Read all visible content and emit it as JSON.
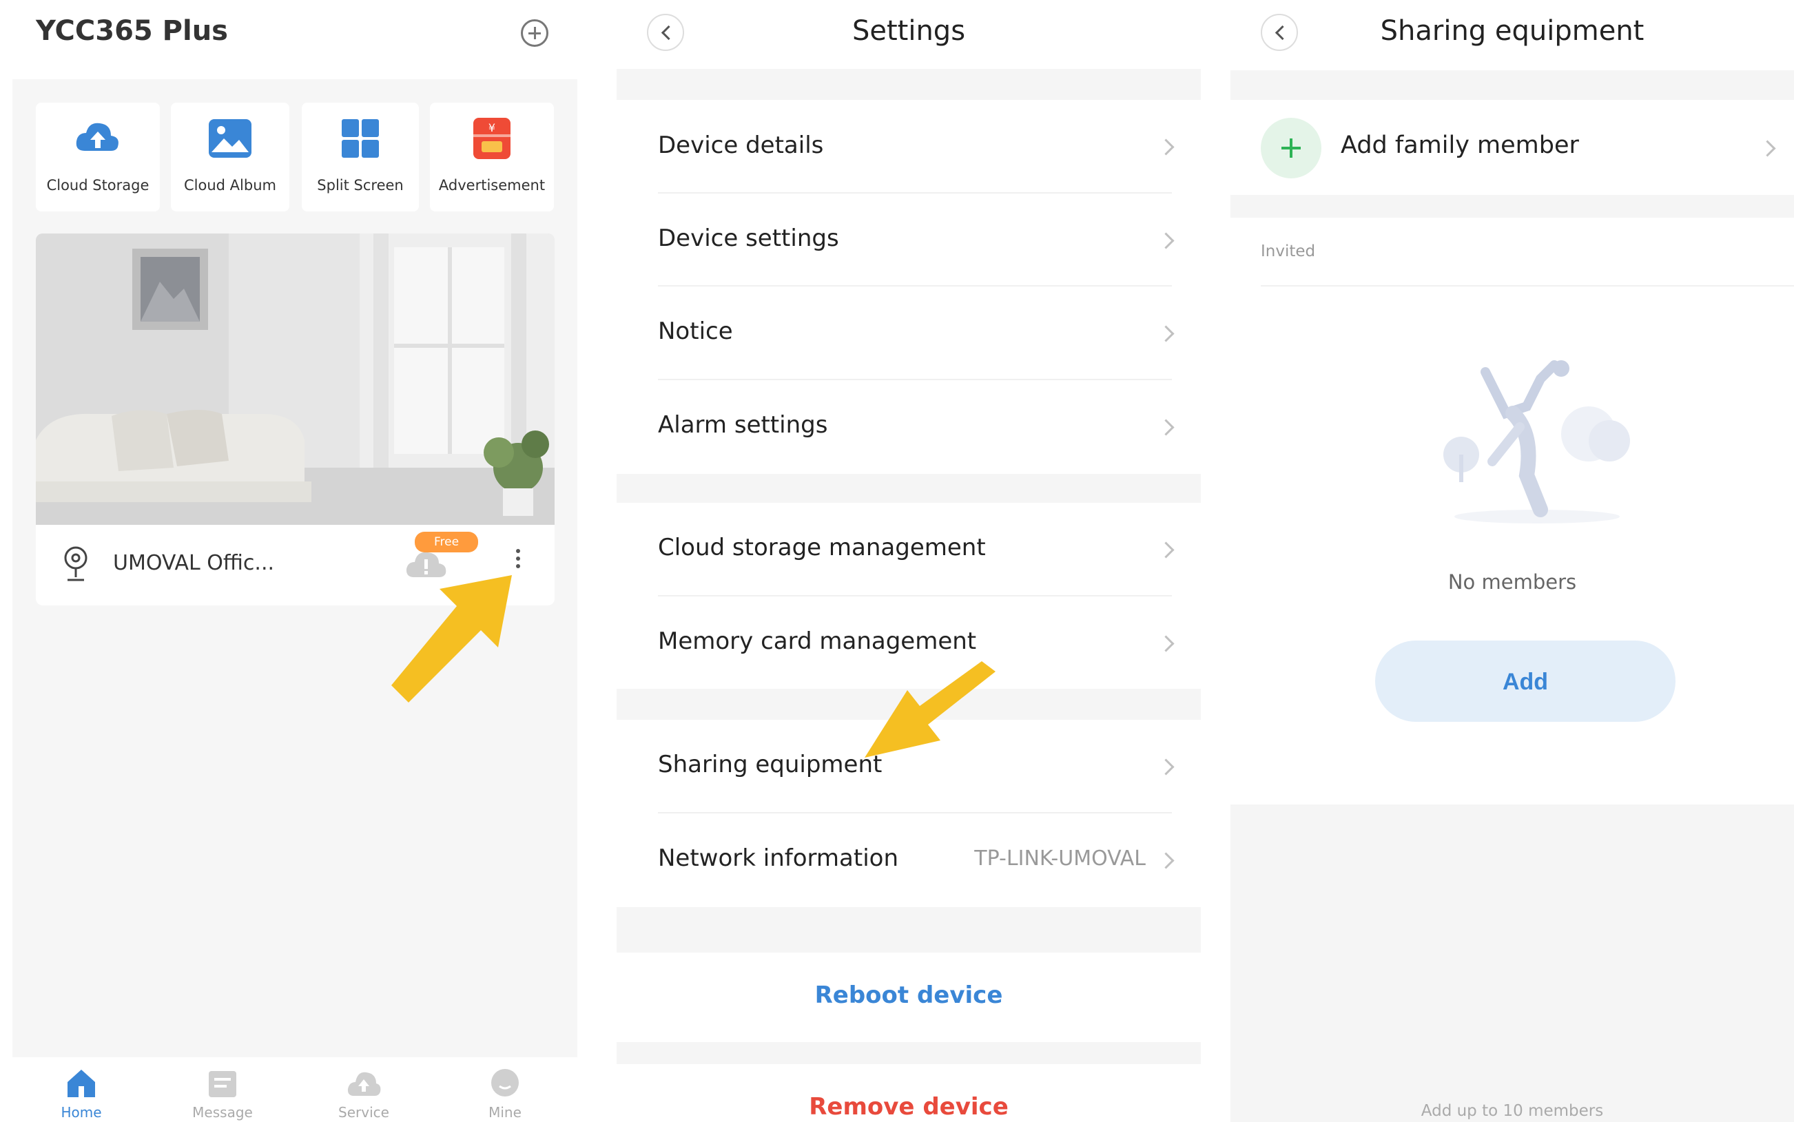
{
  "home": {
    "title": "YCC365 Plus",
    "tiles": [
      {
        "label": "Cloud Storage",
        "icon": "cloud-upload-icon"
      },
      {
        "label": "Cloud Album",
        "icon": "picture-icon"
      },
      {
        "label": "Split Screen",
        "icon": "grid-icon"
      },
      {
        "label": "Advertisement",
        "icon": "coupon-icon"
      }
    ],
    "camera": {
      "name": "UMOVAL Offic...",
      "badge": "Free"
    },
    "tabs": [
      {
        "label": "Home",
        "active": true
      },
      {
        "label": "Message",
        "active": false
      },
      {
        "label": "Service",
        "active": false
      },
      {
        "label": "Mine",
        "active": false
      }
    ]
  },
  "settings": {
    "title": "Settings",
    "group1": [
      "Device details",
      "Device settings",
      "Notice",
      "Alarm settings"
    ],
    "group2": [
      "Cloud storage management",
      "Memory card management"
    ],
    "group3": [
      {
        "label": "Sharing equipment",
        "value": ""
      },
      {
        "label": "Network information",
        "value": "TP-LINK-UMOVAL"
      }
    ],
    "reboot": "Reboot device",
    "remove": "Remove device"
  },
  "sharing": {
    "title": "Sharing equipment",
    "add_family": "Add family member",
    "invited": "Invited",
    "empty_text": "No members",
    "add_button": "Add",
    "footer": "Add up to 10 members"
  },
  "colors": {
    "accent": "#3a86d6",
    "danger": "#e84a3c",
    "green": "#2eb356",
    "arrow": "#f5bf22",
    "badge": "#ff9b3d"
  }
}
